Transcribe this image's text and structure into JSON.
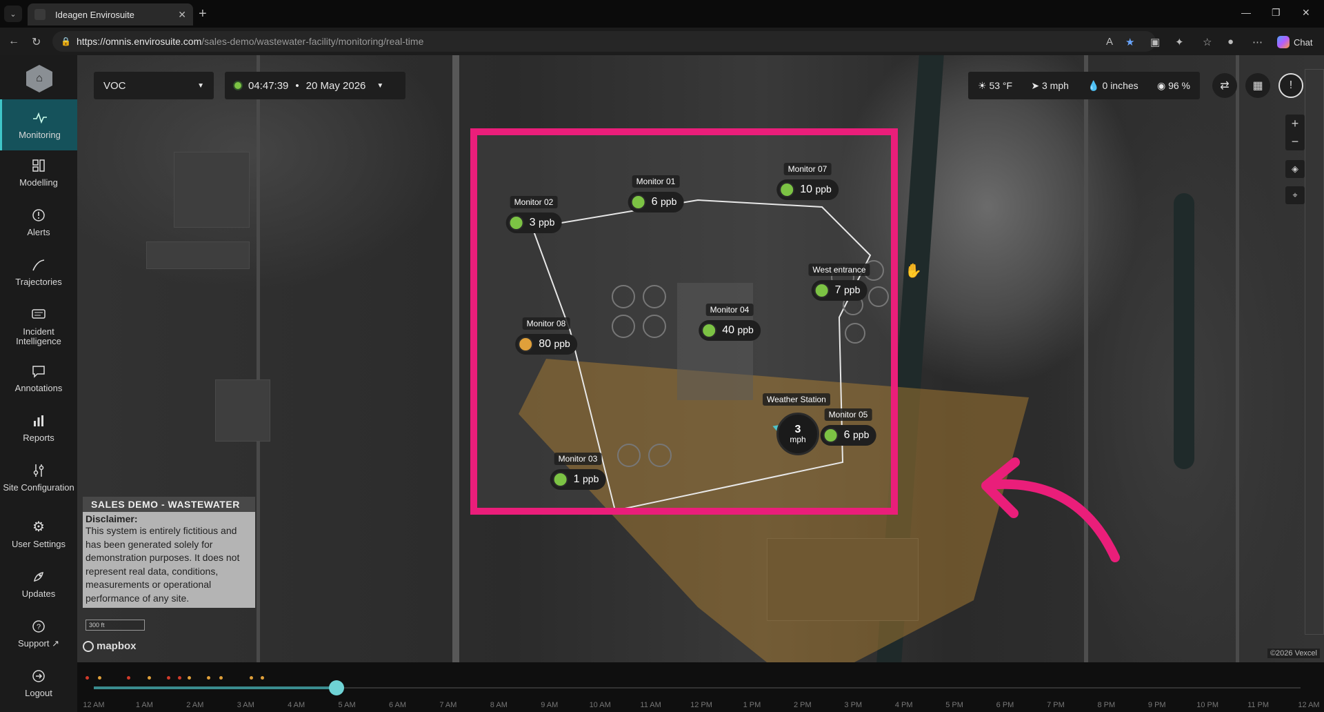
{
  "browser": {
    "tab_title": "Ideagen Envirosuite",
    "url_host": "https://omnis.envirosuite.com",
    "url_path": "/sales-demo/wastewater-facility/monitoring/real-time",
    "chat_label": "Chat"
  },
  "sidebar": {
    "items": [
      {
        "label": "Monitoring",
        "icon": "pulse-icon"
      },
      {
        "label": "Modelling",
        "icon": "model-icon"
      },
      {
        "label": "Alerts",
        "icon": "alert-icon"
      },
      {
        "label": "Trajectories",
        "icon": "trajectory-icon"
      },
      {
        "label": "Incident Intelligence",
        "icon": "incident-icon"
      },
      {
        "label": "Annotations",
        "icon": "annotation-icon"
      },
      {
        "label": "Reports",
        "icon": "reports-icon"
      },
      {
        "label": "Site Configuration",
        "icon": "sliders-icon"
      },
      {
        "label": "User Settings",
        "icon": "gear-icon"
      },
      {
        "label": "Updates",
        "icon": "rocket-icon"
      },
      {
        "label": "Support",
        "icon": "help-icon"
      },
      {
        "label": "Logout",
        "icon": "logout-icon"
      }
    ]
  },
  "toolbar": {
    "pollutant": "VOC",
    "time": "04:47:39",
    "date": "20 May 2026",
    "time_sep": "•"
  },
  "weather": {
    "temp": "53 °F",
    "wind": "3 mph",
    "rain": "0 inches",
    "humidity": "96 %"
  },
  "monitors": [
    {
      "name": "Monitor 01",
      "value": "6",
      "unit": "ppb",
      "status": "green"
    },
    {
      "name": "Monitor 02",
      "value": "3",
      "unit": "ppb",
      "status": "green"
    },
    {
      "name": "Monitor 07",
      "value": "10",
      "unit": "ppb",
      "status": "green"
    },
    {
      "name": "West entrance",
      "value": "7",
      "unit": "ppb",
      "status": "green"
    },
    {
      "name": "Monitor 04",
      "value": "40",
      "unit": "ppb",
      "status": "green"
    },
    {
      "name": "Monitor 08",
      "value": "80",
      "unit": "ppb",
      "status": "amber"
    },
    {
      "name": "Monitor 05",
      "value": "6",
      "unit": "ppb",
      "status": "green"
    },
    {
      "name": "Monitor 03",
      "value": "1",
      "unit": "ppb",
      "status": "green"
    }
  ],
  "weather_station": {
    "label": "Weather Station",
    "speed": "3",
    "unit": "mph"
  },
  "disclaimer": {
    "header": "SALES DEMO - WASTEWATER",
    "title": "Disclaimer:",
    "body": "This system is entirely fictitious and has been generated solely for demonstration purposes. It does not represent real data, conditions, measurements or operational performance of any site."
  },
  "map": {
    "scale": "300 ft",
    "provider": "mapbox",
    "attribution": "©2026 Vexcel"
  },
  "timeline": {
    "labels": [
      "12 AM",
      "1 AM",
      "2 AM",
      "3 AM",
      "4 AM",
      "5 AM",
      "6 AM",
      "7 AM",
      "8 AM",
      "9 AM",
      "10 AM",
      "11 AM",
      "12 PM",
      "1 PM",
      "2 PM",
      "3 PM",
      "4 PM",
      "5 PM",
      "6 PM",
      "7 PM",
      "8 PM",
      "9 PM",
      "10 PM",
      "11 PM",
      "12 AM"
    ],
    "progress": 0.2
  },
  "colors": {
    "accent": "#3fc6c9",
    "highlight": "#ea1e7a",
    "status_green": "#7cc344",
    "status_amber": "#e0a03a"
  }
}
